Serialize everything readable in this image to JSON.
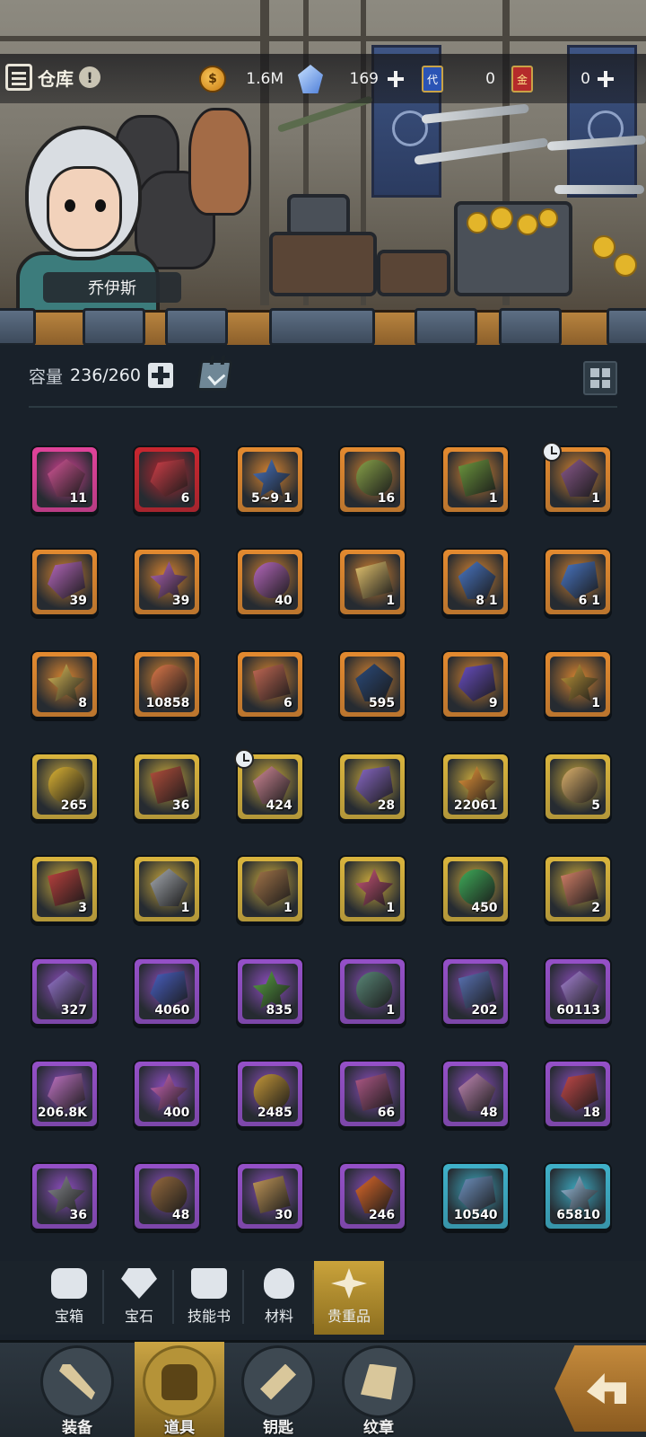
{
  "header": {
    "title": "仓库",
    "character_name": "乔伊斯",
    "resources": [
      {
        "id": "gold",
        "icon": "gold-coin-icon",
        "value": "1.6M",
        "has_plus": false
      },
      {
        "id": "crystal",
        "icon": "blue-crystal-icon",
        "value": "169",
        "has_plus": true
      },
      {
        "id": "ticket_a",
        "icon": "blue-ticket-icon",
        "icon_text": "代",
        "value": "0",
        "has_plus": false
      },
      {
        "id": "ticket_b",
        "icon": "red-ticket-icon",
        "icon_text": "金",
        "value": "0",
        "has_plus": true
      }
    ]
  },
  "capacity": {
    "label": "容量",
    "value": "236/260"
  },
  "items": [
    {
      "icon": "pink-crystal-cluster-icon",
      "count": "11",
      "rarity": "pink",
      "color": "#d8579a"
    },
    {
      "icon": "red-crystal-icon",
      "count": "6",
      "rarity": "red",
      "color": "#d6404a"
    },
    {
      "icon": "star-ticket-icon",
      "count": "5~9 1",
      "rarity": "orange",
      "color": "#4a78c8"
    },
    {
      "icon": "green-herb-branch-icon",
      "count": "16",
      "rarity": "orange",
      "color": "#8aa54a"
    },
    {
      "icon": "red-berry-branch-icon",
      "count": "1",
      "rarity": "orange",
      "color": "#6e9a3e"
    },
    {
      "icon": "mushroom-icon",
      "count": "1",
      "rarity": "orange",
      "color": "#8c5a8e",
      "timer": true
    },
    {
      "icon": "gem-shard-sword-icon",
      "count": "39",
      "rarity": "orange",
      "color": "#b869c0"
    },
    {
      "icon": "gem-shard-ring-icon",
      "count": "39",
      "rarity": "orange",
      "color": "#b869c0"
    },
    {
      "icon": "gem-shard-armor-icon",
      "count": "40",
      "rarity": "orange",
      "color": "#b869c0"
    },
    {
      "icon": "golden-scroll-icon",
      "count": "1",
      "rarity": "orange",
      "color": "#e8c770"
    },
    {
      "icon": "star-ticket-icon",
      "count": "8 1",
      "rarity": "orange",
      "color": "#4a78c8"
    },
    {
      "icon": "star-ticket-icon",
      "count": "6 1",
      "rarity": "orange",
      "color": "#4a78c8"
    },
    {
      "icon": "angel-wing-medal-icon",
      "count": "8",
      "rarity": "orange",
      "color": "#e3c25a"
    },
    {
      "icon": "orange-crystal-icon",
      "count": "10858",
      "rarity": "orange",
      "color": "#e27a4a"
    },
    {
      "icon": "red-scroll-icon",
      "count": "6",
      "rarity": "orange",
      "color": "#c76a55"
    },
    {
      "icon": "dark-blue-crystal-icon",
      "count": "595",
      "rarity": "orange",
      "color": "#2b4c7e"
    },
    {
      "icon": "purple-hourglass-icon",
      "count": "9",
      "rarity": "orange",
      "color": "#6a4fc6"
    },
    {
      "icon": "golden-hammer-icon",
      "count": "1",
      "rarity": "orange",
      "color": "#c79d3a"
    },
    {
      "icon": "gold-ore-icon",
      "count": "265",
      "rarity": "gold",
      "color": "#e1b734"
    },
    {
      "icon": "red-potion-bottle-icon",
      "count": "36",
      "rarity": "gold",
      "color": "#b8503d"
    },
    {
      "icon": "mushroom-coin-icon",
      "count": "424",
      "rarity": "gold",
      "color": "#d58a9a",
      "timer": true
    },
    {
      "icon": "purple-star-shard-icon",
      "count": "28",
      "rarity": "gold",
      "color": "#8c6bcc"
    },
    {
      "icon": "orange-star-crystal-icon",
      "count": "22061",
      "rarity": "gold",
      "color": "#f09a3a"
    },
    {
      "icon": "parchment-icon",
      "count": "5",
      "rarity": "gold",
      "color": "#e0b46e"
    },
    {
      "icon": "red-ribbon-icon",
      "count": "3",
      "rarity": "gold",
      "color": "#c0423f"
    },
    {
      "icon": "steel-ingot-icon",
      "count": "1",
      "rarity": "gold",
      "color": "#a9aeb5"
    },
    {
      "icon": "leather-envelope-icon",
      "count": "1",
      "rarity": "gold",
      "color": "#a7774a"
    },
    {
      "icon": "gem-pile-icon",
      "count": "1",
      "rarity": "gold",
      "color": "#d2577d"
    },
    {
      "icon": "green-potion-icon",
      "count": "450",
      "rarity": "gold",
      "color": "#3fae5a"
    },
    {
      "icon": "scroll-roll-icon",
      "count": "2",
      "rarity": "gold",
      "color": "#d9836a"
    },
    {
      "icon": "purple-stone-icon",
      "count": "327",
      "rarity": "purple",
      "color": "#9a79d6"
    },
    {
      "icon": "blue-spell-page-icon",
      "count": "4060",
      "rarity": "purple",
      "color": "#4a62c8"
    },
    {
      "icon": "green-spell-page-icon",
      "count": "835",
      "rarity": "purple",
      "color": "#5aa845"
    },
    {
      "icon": "stone-bowl-icon",
      "count": "1",
      "rarity": "purple",
      "color": "#5b8a7a"
    },
    {
      "icon": "blue-ring-icon",
      "count": "202",
      "rarity": "purple",
      "color": "#5a74b8"
    },
    {
      "icon": "purple-claw-icon",
      "count": "60113",
      "rarity": "purple",
      "color": "#a884d8"
    },
    {
      "icon": "pink-crystal-cluster-icon",
      "count": "206.8K",
      "rarity": "purple",
      "color": "#c476c9"
    },
    {
      "icon": "pink-gem-shard-icon",
      "count": "400",
      "rarity": "purple",
      "color": "#d46ac0"
    },
    {
      "icon": "star-medal-icon",
      "count": "2485",
      "rarity": "purple",
      "color": "#c89a3a"
    },
    {
      "icon": "pink-cloth-roll-icon",
      "count": "66",
      "rarity": "purple",
      "color": "#b35a8a"
    },
    {
      "icon": "thread-spool-icon",
      "count": "48",
      "rarity": "purple",
      "color": "#c48ab8"
    },
    {
      "icon": "red-cloth-icon",
      "count": "18",
      "rarity": "purple",
      "color": "#c84a4a"
    },
    {
      "icon": "grey-ore-icon",
      "count": "36",
      "rarity": "purple",
      "color": "#8a8d92"
    },
    {
      "icon": "brown-envelope-icon",
      "count": "48",
      "rarity": "purple",
      "color": "#9a6d3f"
    },
    {
      "icon": "wood-block-gems-icon",
      "count": "30",
      "rarity": "purple",
      "color": "#c59a5a"
    },
    {
      "icon": "fire-essence-icon",
      "count": "246",
      "rarity": "purple",
      "color": "#e36b2a"
    },
    {
      "icon": "blue-ore-icon",
      "count": "10540",
      "rarity": "blue",
      "color": "#6f93c2"
    },
    {
      "icon": "ice-crystal-icon",
      "count": "65810",
      "rarity": "blue",
      "color": "#9fc7e8"
    }
  ],
  "sub_tabs": [
    {
      "label": "宝箱",
      "icon": "chest-icon",
      "active": false
    },
    {
      "label": "宝石",
      "icon": "gem-icon",
      "active": false
    },
    {
      "label": "技能书",
      "icon": "book-icon",
      "active": false
    },
    {
      "label": "材料",
      "icon": "materials-icon",
      "active": false
    },
    {
      "label": "贵重品",
      "icon": "star-badge-icon",
      "active": true
    }
  ],
  "bottom_nav": [
    {
      "label": "装备",
      "icon": "equipment-icon",
      "active": false
    },
    {
      "label": "道具",
      "icon": "backpack-icon",
      "active": true
    },
    {
      "label": "钥匙",
      "icon": "key-icon",
      "active": false
    },
    {
      "label": "纹章",
      "icon": "emblem-icon",
      "active": false
    }
  ],
  "colors": {
    "rarity_pink": "#e0439a",
    "rarity_red": "#c8262f",
    "rarity_orange": "#e38a2f",
    "rarity_gold": "#d9b43d",
    "rarity_purple": "#9550c8",
    "rarity_blue": "#3fb1c9",
    "active_tab": "#c9a23a"
  }
}
